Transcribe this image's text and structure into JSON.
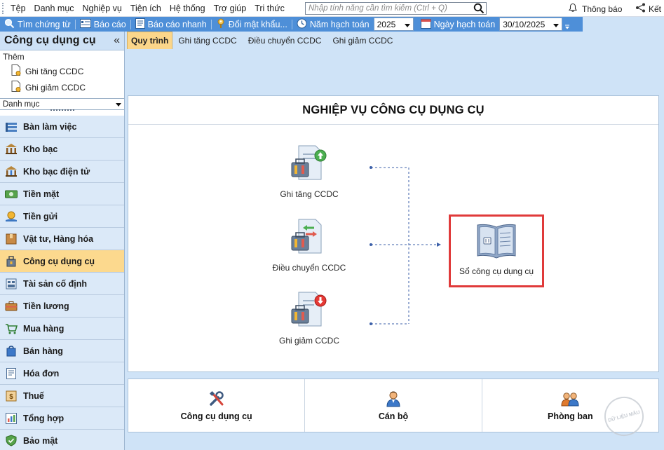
{
  "menubar": {
    "items": [
      "Tệp",
      "Danh mục",
      "Nghiệp vụ",
      "Tiện ích",
      "Hệ thống",
      "Trợ giúp",
      "Tri thức"
    ],
    "search_placeholder": "Nhập tính năng cần tìm kiếm (Ctrl + Q)",
    "notification_label": "Thông báo",
    "connect_label": "Kết"
  },
  "toolbar": {
    "find_voucher": "Tìm chứng từ",
    "report": "Báo cáo",
    "quick_report": "Báo cáo nhanh",
    "change_password": "Đổi mật khẩu...",
    "fiscal_year_label": "Năm hạch toán",
    "fiscal_year_value": "2025",
    "posting_date_label": "Ngày hạch toán",
    "posting_date_value": "30/10/2025"
  },
  "sidebar": {
    "title": "Công cụ dụng cụ",
    "collapse_glyph": "«",
    "add_label": "Thêm",
    "add_items": [
      "Ghi tăng CCDC",
      "Ghi giảm CCDC"
    ],
    "category_dropdown": "Danh mục",
    "nav": [
      {
        "label": "Bàn làm việc",
        "icon": "desk-icon"
      },
      {
        "label": "Kho bạc",
        "icon": "treasury-icon"
      },
      {
        "label": "Kho bạc điện tử",
        "icon": "e-treasury-icon"
      },
      {
        "label": "Tiền mặt",
        "icon": "cash-icon"
      },
      {
        "label": "Tiền gửi",
        "icon": "deposit-icon"
      },
      {
        "label": "Vật tư, Hàng hóa",
        "icon": "goods-icon"
      },
      {
        "label": "Công cụ dụng cụ",
        "icon": "tools-icon"
      },
      {
        "label": "Tài sản cố định",
        "icon": "fixed-asset-icon"
      },
      {
        "label": "Tiền lương",
        "icon": "salary-icon"
      },
      {
        "label": "Mua hàng",
        "icon": "purchase-icon"
      },
      {
        "label": "Bán hàng",
        "icon": "sales-icon"
      },
      {
        "label": "Hóa đơn",
        "icon": "invoice-icon"
      },
      {
        "label": "Thuế",
        "icon": "tax-icon"
      },
      {
        "label": "Tổng hợp",
        "icon": "summary-icon"
      },
      {
        "label": "Bảo mật",
        "icon": "security-icon"
      }
    ]
  },
  "tabs": [
    "Quy trình",
    "Ghi tăng CCDC",
    "Điều chuyển CCDC",
    "Ghi giảm CCDC"
  ],
  "main": {
    "title": "NGHIỆP VỤ CÔNG CỤ DỤNG CỤ",
    "flow": {
      "increase": "Ghi tăng CCDC",
      "transfer": "Điều chuyển CCDC",
      "decrease": "Ghi giảm CCDC",
      "ledger": "Sổ công cụ dụng cụ"
    }
  },
  "bottom": {
    "tools": "Công cụ dụng cụ",
    "staff": "Cán bộ",
    "department": "Phòng ban"
  },
  "watermark": "DỮ LIỆU MẪU",
  "colors": {
    "toolbar_bg": "#4e8fd8",
    "nav_bg": "#dbe9f8",
    "nav_active": "#fcd98e",
    "highlight_border": "#e03a3a",
    "app_bg": "#cfe3f7"
  }
}
